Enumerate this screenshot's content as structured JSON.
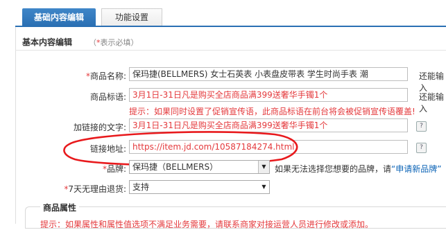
{
  "tabs": [
    {
      "label": "基础内容编辑",
      "active": true
    },
    {
      "label": "功能设置",
      "active": false
    }
  ],
  "section": {
    "title": "基本内容编辑",
    "hint_prefix": "（",
    "hint_star": "*",
    "hint_text": "表示必填）"
  },
  "form": {
    "name": {
      "star": "*",
      "label": "商品名称:",
      "value": "保玛捷(BELLMERS) 女士石英表 小表盘皮带表 学生时尚手表 潮",
      "side": "还能输入"
    },
    "slogan": {
      "label": "商品标语:",
      "value": "3月1日-31日凡是购买全店商品满399送奢华手镯1个",
      "side": "还能输入"
    },
    "warning": "提示：如果同时设置了促销宣传语，此商品标语在前台将会被促销宣传语覆盖!",
    "link_text": {
      "label": "加链接的文字:",
      "value": "3月1日-31日凡是购买全店商品满399送奢华手镯1个"
    },
    "link_url": {
      "label": "链接地址:",
      "value": "https://item.jd.com/10587184274.html"
    },
    "brand": {
      "star": "*",
      "label": "品牌:",
      "value": "保玛捷（BELLMERS）",
      "hint": "如果无法选择您想要的品牌，请",
      "link": "“申请新品牌”"
    },
    "return": {
      "star": "*",
      "label": "7天无理由退货:",
      "value": "支持"
    },
    "help_glyph": "?"
  },
  "attributes": {
    "title": "商品属性",
    "tip": "提示：如果属性和属性值选项不满足业务需要，请联系商家对接运营人员进行修改或添加。"
  },
  "annotation": {
    "color": "#e8191c"
  },
  "colors": {
    "accent": "#2a6fb3",
    "required": "#e4393c",
    "link": "#0b63b6"
  }
}
